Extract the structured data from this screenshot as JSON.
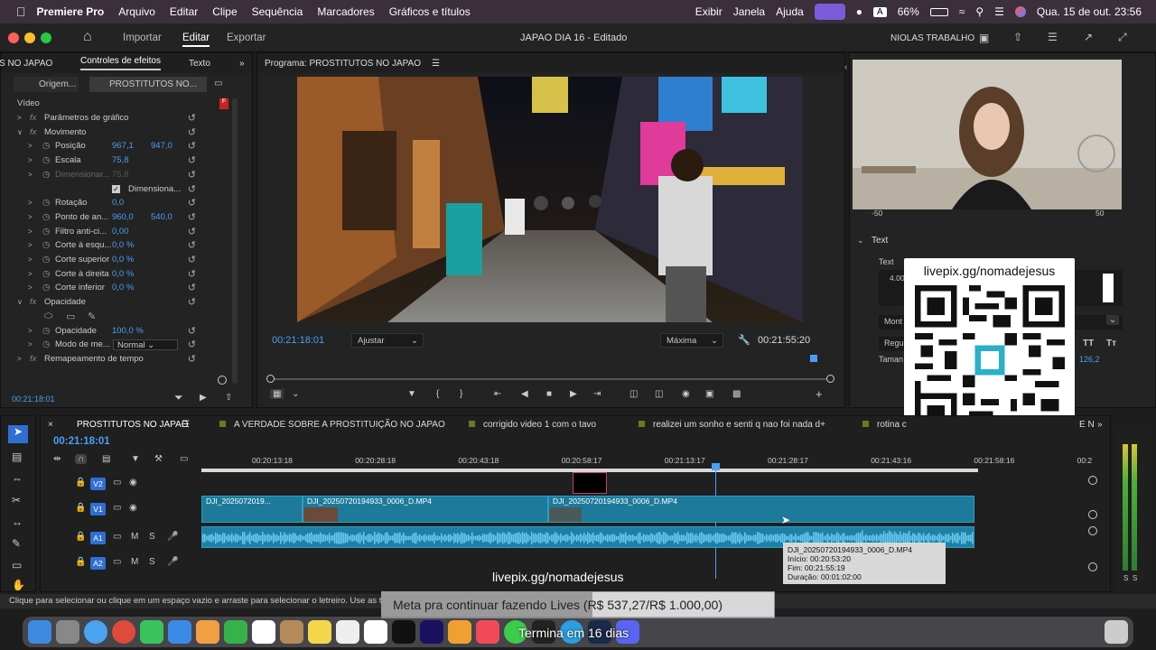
{
  "menubar": {
    "app": "Premiere Pro",
    "items": [
      "Arquivo",
      "Editar",
      "Clipe",
      "Sequência",
      "Marcadores",
      "Gráficos e títulos"
    ],
    "right_items": [
      "Exibir",
      "Janela",
      "Ajuda"
    ],
    "battery": "66%",
    "clock": "Qua. 15 de out.  23:56",
    "input_lang": "A"
  },
  "titlebar": {
    "tabs": [
      "Importar",
      "Editar",
      "Exportar"
    ],
    "active_tab": "Editar",
    "project_title": "JAPAO DIA 16 - Editado",
    "workspace": "NIOLAS TRABALHO"
  },
  "effects": {
    "tabs": [
      "S NO JAPAO",
      "Controles de efeitos",
      "Texto"
    ],
    "source_label": "Origem...",
    "clip_label": "PROSTITUTOS NO...",
    "section": "Vídeo",
    "rows": [
      {
        "label": "Parâmetros de gráfico",
        "indent": 1,
        "fx": true
      },
      {
        "label": "Movimento",
        "indent": 1,
        "fx": true,
        "open": true
      },
      {
        "label": "Posição",
        "v1": "967,1",
        "v2": "947,0",
        "indent": 2
      },
      {
        "label": "Escala",
        "v1": "75,8",
        "indent": 2
      },
      {
        "label": "Dimensionar...",
        "v1": "75,8",
        "indent": 2,
        "dim": true
      },
      {
        "label": "Dimensiona...",
        "indent": 3,
        "check": true
      },
      {
        "label": "Rotação",
        "v1": "0,0",
        "indent": 2
      },
      {
        "label": "Ponto de an...",
        "v1": "960,0",
        "v2": "540,0",
        "indent": 2
      },
      {
        "label": "Filtro anti-ci...",
        "v1": "0,00",
        "indent": 2
      },
      {
        "label": "Corte à esqu...",
        "v1": "0,0 %",
        "indent": 2
      },
      {
        "label": "Corte superior",
        "v1": "0,0 %",
        "indent": 2
      },
      {
        "label": "Corte à direita",
        "v1": "0,0 %",
        "indent": 2
      },
      {
        "label": "Corte inferior",
        "v1": "0,0 %",
        "indent": 2
      },
      {
        "label": "Opacidade",
        "indent": 1,
        "fx": true,
        "open": true
      },
      {
        "label": "",
        "indent": 2,
        "shapes": true
      },
      {
        "label": "Opacidade",
        "v1": "100,0 %",
        "indent": 2
      },
      {
        "label": "Modo de me...",
        "select": "Normal",
        "indent": 2
      },
      {
        "label": "Remapeamento de tempo",
        "indent": 1,
        "fx": true
      }
    ],
    "timecode": "00:21:18:01"
  },
  "program": {
    "title": "Programa: PROSTITUTOS NO JAPAO",
    "timecode": "00:21:18:01",
    "fit": "Ajustar",
    "quality": "Máxima",
    "duration": "00:21:55:20"
  },
  "right": {
    "slider_min": "-50",
    "slider_max": "50",
    "text_section": "Text",
    "text_label": "Text",
    "value_a": "4.00",
    "font_label": "Mont",
    "style_label": "Regu",
    "size_label": "Taman",
    "size_value": "126,2",
    "tt1": "TT",
    "tt2": "Tт"
  },
  "qr": {
    "url": "livepix.gg/nomadejesus"
  },
  "timeline": {
    "seq_tabs": [
      "PROSTITUTOS NO JAPAO",
      "A VERDADE SOBRE A PROSTITUIÇÃO NO JAPAO",
      "corrigido video 1 com o tavo",
      "realizei um sonho e senti q nao foi nada d+",
      "rotina c"
    ],
    "seq_tab_tail": "E N",
    "timecode": "00:21:18:01",
    "ruler": [
      "00:20:13:18",
      "00:20:28:18",
      "00:20:43:18",
      "00:20:58:17",
      "00:21:13:17",
      "00:21:28:17",
      "00:21:43:16",
      "00:21:58:16",
      "00:2"
    ],
    "tracks": [
      "V2",
      "V1",
      "A1",
      "A2"
    ],
    "clips": [
      "DJI_2025072019...",
      "DJI_20250720194933_0006_D.MP4",
      "DJI_20250720194933_0006_D.MP4"
    ],
    "tooltip": {
      "name": "DJI_20250720194933_0006_D.MP4",
      "inicio": "Início: 00:20:53:20",
      "fim": "Fim: 00:21:55:19",
      "duracao": "Duração: 00:01:02:00"
    },
    "meter_s": "S",
    "overlay_url": "livepix.gg/nomadejesus"
  },
  "status": "Clique para selecionar ou clique em um espaço vazio e arraste para selecionar o letreiro. Use as te",
  "goal": {
    "text": "Meta pra continuar fazendo Lives (R$ 537,27/R$ 1.000,00)",
    "progress": 0.537,
    "sub": "Termina em 16 dias"
  }
}
